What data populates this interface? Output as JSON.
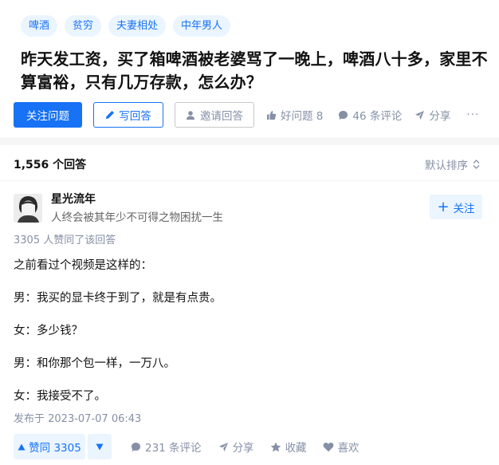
{
  "question": {
    "tags": [
      "啤酒",
      "贫穷",
      "夫妻相处",
      "中年男人"
    ],
    "title": "昨天发工资，买了箱啤酒被老婆骂了一晚上，啤酒八十多，家里不算富裕，只有几万存款，怎么办？",
    "actions": {
      "follow": "关注问题",
      "write": "写回答",
      "invite": "邀请回答",
      "good_question": "好问题 8",
      "comments": "46 条评论",
      "share": "分享",
      "more": "···"
    }
  },
  "answers": {
    "count_label": "1,556 个回答",
    "sort_label": "默认排序",
    "item": {
      "author_name": "星光流年",
      "author_bio": "人终会被其年少不可得之物困扰一生",
      "follow_label": "关注",
      "upvoters": "3305 人赞同了该回答",
      "paragraphs": [
        "之前看过个视频是这样的：",
        "男：我买的显卡终于到了，就是有点贵。",
        "女：多少钱？",
        "男：和你那个包一样，一万八。",
        "女：我接受不了。"
      ],
      "published": "发布于 2023-07-07 06:43",
      "vote_label": "赞同 3305",
      "comments": "231 条评论",
      "share": "分享",
      "favorite": "收藏",
      "like": "喜欢"
    }
  },
  "colors": {
    "accent": "#1772f6",
    "muted": "#8590a6",
    "accent_bg": "#ebf5ff"
  }
}
